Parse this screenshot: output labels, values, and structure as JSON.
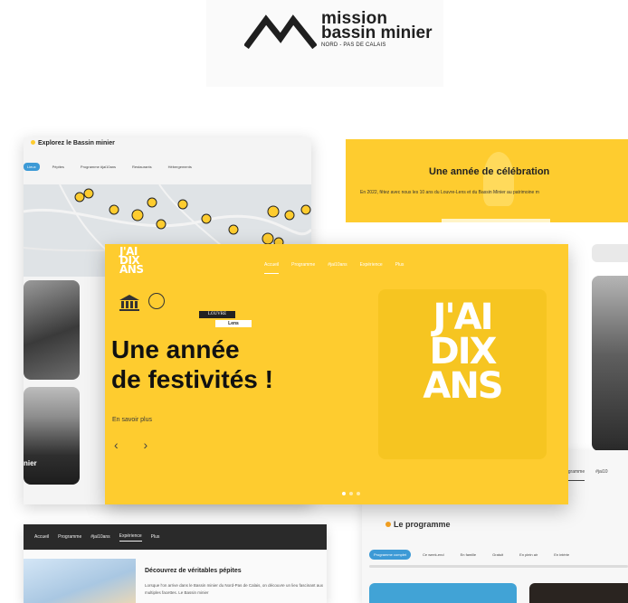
{
  "brand": {
    "line1": "mission",
    "line2": "bassin minier",
    "line3": "NORD - PAS DE CALAIS"
  },
  "map_card": {
    "title": "Explorez le Bassin minier",
    "tabs": [
      "Lieux",
      "Pépites",
      "Programme #jai10ans",
      "Restaurants",
      "Hébergements"
    ],
    "photo_label": "nier"
  },
  "celebration": {
    "title": "Une année de célébration",
    "subtitle": "En 2022, fêtez avec nous les 10 ans du Louvre-Lens et du Bassin Minier au patrimoine m"
  },
  "hero": {
    "logo_lines": [
      "J'AI",
      "DIX",
      "ANS"
    ],
    "nav": [
      "Accueil",
      "Programme",
      "#jai10ans",
      "Expérience",
      "Plus"
    ],
    "nav_icons": [
      "home-icon",
      "calendar-icon",
      "hash-icon",
      "cloud-icon",
      "chevron-down-icon"
    ],
    "badge_louvre": "LOUVRE",
    "badge_lens": "Lens",
    "title_line1": "Une année",
    "title_line2": "de festivités !",
    "link": "En savoir plus",
    "arrows": "‹ ›",
    "poster_lines": [
      "J'AI",
      "DIX",
      "ANS"
    ]
  },
  "dark_page": {
    "nav": [
      "Accueil",
      "Programme",
      "#jai10ans",
      "Expérience",
      "Plus"
    ],
    "heading": "Découvrez de véritables pépites",
    "text": "Lorsque l'on arrive dans le Bassin minier du Nord-Pas de Calais, on découvre un lieu fascinant aux multiples facettes. Le Bassin minier"
  },
  "programme": {
    "tabs": [
      "Programme",
      "#jai10"
    ],
    "title": "Le programme",
    "filters": [
      "Programme complet",
      "Ce week-end",
      "En famille",
      "Gratuit",
      "En plein air",
      "En intérie"
    ]
  },
  "colors": {
    "brand_yellow": "#fecc2f",
    "accent_blue": "#3d9ad6",
    "dark": "#2a2a2a"
  }
}
